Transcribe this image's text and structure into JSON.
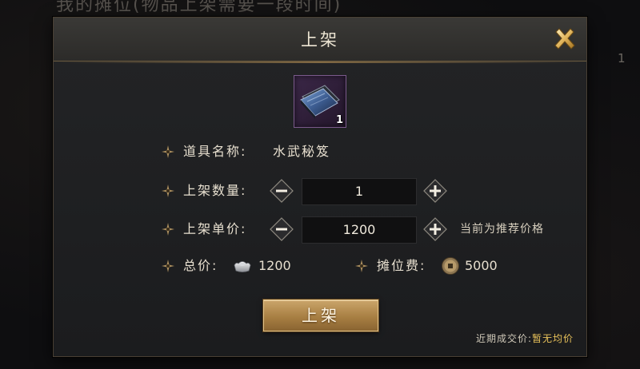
{
  "background": {
    "title": "我的摊位(物品上架需要一段时间)",
    "side_number": "1"
  },
  "dialog": {
    "title": "上架",
    "close_icon": "close-x-icon"
  },
  "item": {
    "icon": "martial-arts-book-icon",
    "count": "1",
    "rarity_color": "#7b5a8c"
  },
  "fields": {
    "name_label": "道具名称:",
    "name_value": "水武秘笈",
    "quantity_label": "上架数量:",
    "quantity_value": "1",
    "price_label": "上架单价:",
    "price_value": "1200",
    "price_note": "当前为推荐价格",
    "total_label": "总价:",
    "total_value": "1200",
    "total_icon": "silver-ingot-icon",
    "fee_label": "摊位费:",
    "fee_value": "5000",
    "fee_icon": "copper-coin-icon"
  },
  "actions": {
    "submit_label": "上架"
  },
  "recent_trade": {
    "label": "近期成交价:",
    "value": "暂无均价"
  },
  "colors": {
    "accent_gold": "#caa56a",
    "highlight_yellow": "#e9c25a",
    "text_light": "#e7dfcf"
  }
}
